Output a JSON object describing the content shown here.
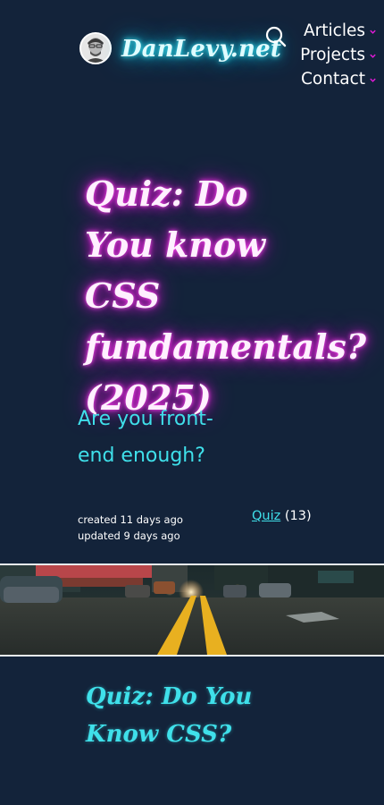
{
  "site": {
    "title": "DanLevy.net"
  },
  "nav": {
    "items": [
      {
        "label": "Articles"
      },
      {
        "label": "Projects"
      },
      {
        "label": "Contact"
      }
    ]
  },
  "icons": {
    "search": "search-icon",
    "chevron": "chevron-down-icon",
    "avatar": "avatar"
  },
  "colors": {
    "background": "#13233a",
    "accent_cyan": "#3fe0ea",
    "accent_magenta": "#e31ad8",
    "chevron": "#e31ad8"
  },
  "article": {
    "title": "Quiz: Do You know CSS fundamentals? (2025)",
    "subtitle": "Are you front-end enough?",
    "created": "created 11 days ago",
    "updated": "updated 9 days ago",
    "tag": "Quiz",
    "tag_count": "(13)"
  },
  "card": {
    "title": "Quiz: Do You Know CSS?"
  }
}
